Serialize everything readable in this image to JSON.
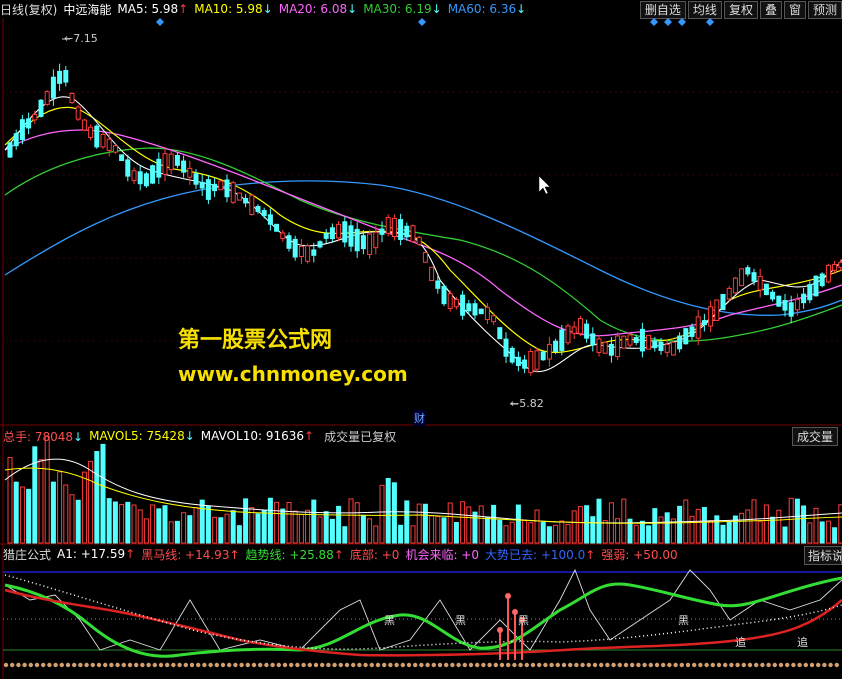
{
  "header": {
    "period": "日线(复权)",
    "stock": "中远海能",
    "ma5": "MA5: 5.98",
    "ma5_arrow": "↑",
    "ma10": "MA10: 5.98",
    "ma10_arrow": "↓",
    "ma20": "MA20: 6.08",
    "ma20_arrow": "↓",
    "ma30": "MA30: 6.19",
    "ma30_arrow": "↓",
    "ma60": "MA60: 6.36",
    "ma60_arrow": "↓"
  },
  "toolbar": {
    "b1": "删自选",
    "b2": "均线",
    "b3": "复权",
    "b4": "叠",
    "b5": "窗",
    "b6": "预测"
  },
  "price_panel": {
    "high_label": "7.15",
    "low_label": "5.82",
    "cai_mark": "财"
  },
  "watermark": {
    "line1": "第一股票公式网",
    "line2": "www.chnmoney.com"
  },
  "volume_panel": {
    "total": "总手: 78048",
    "total_arrow": "↓",
    "mavol5": "MAVOL5: 75428",
    "mavol5_arrow": "↓",
    "mavol10": "MAVOL10: 91636",
    "mavol10_arrow": "↑",
    "note": "成交量已复权",
    "right_label": "成交量"
  },
  "indicator_panel": {
    "name": "猎庄公式",
    "a1": "A1: +17.59",
    "a1_arrow": "↑",
    "heima": "黑马线: +14.93",
    "heima_arrow": "↑",
    "qushi": "趋势线: +25.88",
    "qushi_arrow": "↑",
    "dibu": "底部: +0",
    "jihui": "机会来临: +0",
    "dashi": "大势已去: +100.0",
    "dashi_arrow": "↑",
    "qiangruo": "强弱: +50.00",
    "right_label": "指标说",
    "hei": "黑",
    "zhui": "追"
  },
  "colors": {
    "up": "#ff3b3b",
    "down": "#54ffff",
    "ma5": "#ffffff",
    "ma10": "#ffff00",
    "ma20": "#ff66ff",
    "ma30": "#33cc33",
    "ma60": "#3399ff"
  }
}
